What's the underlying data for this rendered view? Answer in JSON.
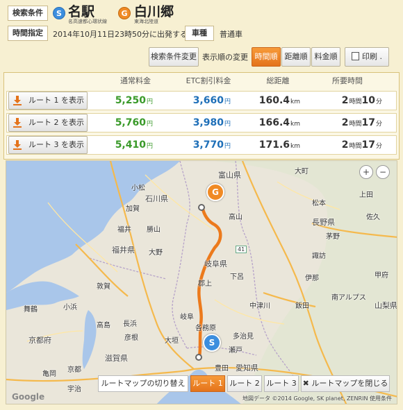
{
  "header": {
    "cond_label": "検索条件",
    "start": {
      "mark": "S",
      "name": "名駅",
      "sub": "名高速都心環状線"
    },
    "goal": {
      "mark": "G",
      "name": "白川郷",
      "sub": "東海北陸道"
    },
    "time_label": "時間指定",
    "time_value": "2014年10月11日23時50分に出発する",
    "car_label": "車種",
    "car_value": "普通車"
  },
  "toolbar": {
    "change": "検索条件変更",
    "order_label": "表示順の変更",
    "sort_time": "時間順",
    "sort_dist": "距離順",
    "sort_fare": "料金順",
    "print": "印刷 ."
  },
  "table": {
    "headers": {
      "normal": "通常料金",
      "etc": "ETC割引料金",
      "dist": "総距離",
      "time": "所要時間"
    },
    "routes": [
      {
        "label": "ルート 1 を表示",
        "normal": "5,250",
        "etc": "3,660",
        "dist": "160.4",
        "hour": "2",
        "min": "10"
      },
      {
        "label": "ルート 2 を表示",
        "normal": "5,760",
        "etc": "3,980",
        "dist": "166.4",
        "hour": "2",
        "min": "17"
      },
      {
        "label": "ルート 3 を表示",
        "normal": "5,410",
        "etc": "3,770",
        "dist": "171.6",
        "hour": "2",
        "min": "17"
      }
    ],
    "units": {
      "yen": "円",
      "km": "km",
      "hour": "時間",
      "min": "分"
    }
  },
  "map": {
    "labels": {
      "toyama": "富山県",
      "ishikawa": "石川県",
      "fukui": "福井県",
      "gifu": "岐阜県",
      "nagano": "長野県",
      "shiga": "滋賀県",
      "kyoto": "京都府",
      "aichi": "愛知県",
      "yamanashi": "山梨県",
      "komatsu": "小松",
      "kaga": "加賀",
      "fukui_c": "福井",
      "katsuyama": "勝山",
      "ono": "大野",
      "tsuruga": "敦賀",
      "obama": "小浜",
      "maizuru": "舞鶴",
      "takashima": "高島",
      "nagahama": "長浜",
      "hikone": "彦根",
      "ogaki": "大垣",
      "gifu_c": "岐阜",
      "kakamigahara": "各務原",
      "tajimi": "多治見",
      "seto": "瀬戸",
      "toyota": "豊田",
      "kyoto_c": "京都",
      "uji": "宇治",
      "kameoka": "亀岡",
      "takayama": "高山",
      "gujo": "郡上",
      "gero": "下呂",
      "nakatsugawa": "中津川",
      "iida": "飯田",
      "ina": "伊那",
      "chino": "茅野",
      "suwa": "諏訪",
      "matsumoto": "松本",
      "saku": "佐久",
      "omachi": "大町",
      "ueda": "上田",
      "kofu": "甲府",
      "minami_alps": "南アルプス",
      "route41": "41"
    },
    "bar_label": "ルートマップの切り替え",
    "r1": "ルート 1",
    "r2": "ルート 2",
    "r3": "ルート 3",
    "close": "ルートマップを閉じる",
    "copyright": "地図データ ©2014 Google, SK planet, ZENRIN  使用条件",
    "google": "Google",
    "zoom_in": "+",
    "zoom_out": "−"
  }
}
